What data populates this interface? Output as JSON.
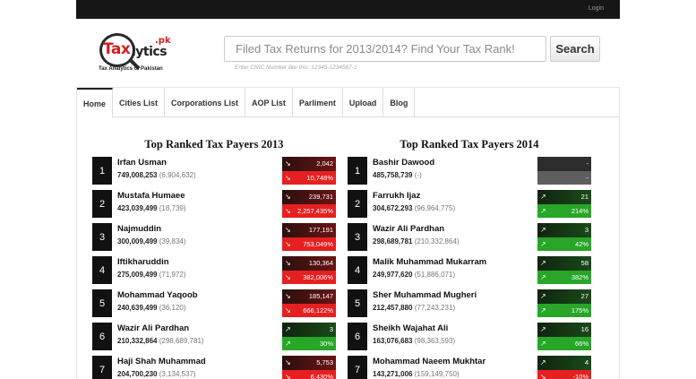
{
  "header": {
    "login_label": "Login"
  },
  "logo": {
    "tax": "Tax",
    "lytics": "lytics",
    "pk": ".pk",
    "tagline": "Tax Analytics of Pakistan"
  },
  "search": {
    "placeholder": "Filed Tax Returns for 2013/2014? Find Your Tax Rank!",
    "hint": "Enter CNIC Number like this: 12345-1234567-1",
    "button_label": "Search"
  },
  "nav": [
    {
      "label": "Home"
    },
    {
      "label": "Cities List"
    },
    {
      "label": "Corporations List"
    },
    {
      "label": "AOP List"
    },
    {
      "label": "Parliment"
    },
    {
      "label": "Upload"
    },
    {
      "label": "Blog"
    }
  ],
  "colors": {
    "down_dark": "#6a1414",
    "down": "#e62020",
    "up_dark": "#1a4a1a",
    "up": "#27a627",
    "neutral": "#5e5e5e"
  },
  "panels": [
    {
      "title": "Top Ranked Tax Payers 2013",
      "rows": [
        {
          "rank": "1",
          "name": "Irfan Usman",
          "amount": "749,008,253",
          "prev": "(6,904,632)",
          "rank_change": "2,042",
          "pct_change": "10,748%",
          "trend": "down"
        },
        {
          "rank": "2",
          "name": "Mustafa Humaee",
          "amount": "423,039,499",
          "prev": "(18,739)",
          "rank_change": "239,731",
          "pct_change": "2,257,435%",
          "trend": "down"
        },
        {
          "rank": "3",
          "name": "Najmuddin",
          "amount": "300,009,499",
          "prev": "(39,834)",
          "rank_change": "177,191",
          "pct_change": "753,049%",
          "trend": "down"
        },
        {
          "rank": "4",
          "name": "Iftikharuddin",
          "amount": "275,009,499",
          "prev": "(71,972)",
          "rank_change": "130,364",
          "pct_change": "382,006%",
          "trend": "down"
        },
        {
          "rank": "5",
          "name": "Mohammad Yaqoob",
          "amount": "240,639,499",
          "prev": "(36,120)",
          "rank_change": "185,147",
          "pct_change": "666,122%",
          "trend": "down"
        },
        {
          "rank": "6",
          "name": "Wazir Ali Pardhan",
          "amount": "210,332,864",
          "prev": "(298,689,781)",
          "rank_change": "3",
          "pct_change": "30%",
          "trend": "up"
        },
        {
          "rank": "7",
          "name": "Haji Shah Muhammad",
          "amount": "204,700,230",
          "prev": "(3,134,537)",
          "rank_change": "5,753",
          "pct_change": "6,430%",
          "trend": "down"
        }
      ]
    },
    {
      "title": "Top Ranked Tax Payers 2014",
      "rows": [
        {
          "rank": "1",
          "name": "Bashir Dawood",
          "amount": "485,758,739",
          "prev": "(-)",
          "rank_change": "-",
          "pct_change": "-",
          "trend": "neutral"
        },
        {
          "rank": "2",
          "name": "Farrukh Ijaz",
          "amount": "304,672,293",
          "prev": "(96,964,775)",
          "rank_change": "21",
          "pct_change": "214%",
          "trend": "up"
        },
        {
          "rank": "3",
          "name": "Wazir Ali Pardhan",
          "amount": "298,689,781",
          "prev": "(210,332,864)",
          "rank_change": "3",
          "pct_change": "42%",
          "trend": "up"
        },
        {
          "rank": "4",
          "name": "Malik Muhammad Mukarram",
          "amount": "249,977,620",
          "prev": "(51,886,071)",
          "rank_change": "58",
          "pct_change": "382%",
          "trend": "up"
        },
        {
          "rank": "5",
          "name": "Sher Muhammad Mugheri",
          "amount": "212,457,880",
          "prev": "(77,243,231)",
          "rank_change": "27",
          "pct_change": "175%",
          "trend": "up"
        },
        {
          "rank": "6",
          "name": "Sheikh Wajahat Ali",
          "amount": "163,076,683",
          "prev": "(98,363,593)",
          "rank_change": "16",
          "pct_change": "66%",
          "trend": "up"
        },
        {
          "rank": "7",
          "name": "Mohammad Naeem Mukhtar",
          "amount": "143,271,006",
          "prev": "(159,149,750)",
          "rank_change": "4",
          "pct_change": "-10%",
          "trend": "mixed"
        }
      ]
    }
  ]
}
